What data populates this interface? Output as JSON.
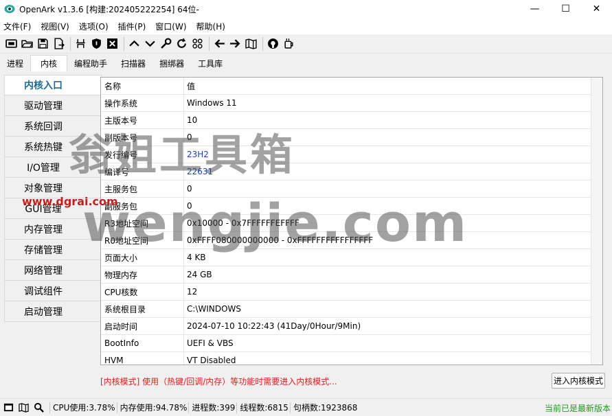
{
  "window": {
    "title": "OpenArk v1.3.6 [构建:202405222254]  64位-",
    "minimize": "—",
    "maximize": "☐",
    "close": "✕"
  },
  "menu": [
    "文件(F)",
    "视图(V)",
    "选项(O)",
    "插件(P)",
    "窗口(W)",
    "帮助(H)"
  ],
  "toolbar_icons": [
    "console-icon",
    "open-folder-icon",
    "save-icon",
    "file-export-icon",
    "find-window-icon",
    "shield-icon",
    "close-square-icon",
    "up-arrow-icon",
    "down-arrow-icon",
    "wrench-icon",
    "refresh-icon",
    "grid-icon",
    "arrow-left-icon",
    "arrow-right-icon",
    "book-icon",
    "github-icon",
    "coffee-icon"
  ],
  "tabs": [
    "进程",
    "内核",
    "编程助手",
    "扫描器",
    "捆绑器",
    "工具库"
  ],
  "active_tab": 1,
  "sidebar": [
    "内核入口",
    "驱动管理",
    "系统回调",
    "系统热键",
    "I/O管理",
    "对象管理",
    "GUI管理",
    "内存管理",
    "存储管理",
    "网络管理",
    "调试组件",
    "启动管理"
  ],
  "active_sidebar": 0,
  "table": {
    "headers": [
      "名称",
      "值"
    ],
    "rows": [
      [
        "操作系统",
        "Windows 11"
      ],
      [
        "主版本号",
        "10"
      ],
      [
        "副版本号",
        "0"
      ],
      [
        "发行编号",
        "23H2"
      ],
      [
        "编译号",
        "22631"
      ],
      [
        "主服务包",
        "0"
      ],
      [
        "副服务包",
        "0"
      ],
      [
        "R3地址空间",
        "0x10000 - 0x7FFFFFFEFFFF"
      ],
      [
        "R0地址空间",
        "0xFFFF080000000000 - 0xFFFFFFFFFFFFFFFF"
      ],
      [
        "页面大小",
        "4 KB"
      ],
      [
        "物理内存",
        "24 GB"
      ],
      [
        "CPU核数",
        "12"
      ],
      [
        "系统根目录",
        "C:\\WINDOWS"
      ],
      [
        "启动时间",
        "2024-07-10 10:22:43 (41Day/0Hour/9Min)"
      ],
      [
        "BootInfo",
        "UEFI & VBS"
      ],
      [
        "HVM",
        "VT Disabled"
      ]
    ]
  },
  "kernel_hint": "[内核模式] 使用（热键/回调/内存）等功能时需要进入内核模式...",
  "enter_kernel_button": "进入内核模式",
  "status": {
    "cpu": "CPU使用:3.78%",
    "mem": "内存使用:94.78%",
    "procs": "进程数:399",
    "threads": "线程数:6815",
    "handles": "句柄数:1923868",
    "latest": "当前已是最新版本"
  },
  "watermark": {
    "line1": "翁姐工具箱",
    "line2": "wengjie.com",
    "line3": "www.dgrai.com"
  },
  "colors": {
    "accent": "#1d6b8f",
    "link": "#1b3fbf",
    "hint": "#e01e1e",
    "latest": "#1e9c1e"
  }
}
